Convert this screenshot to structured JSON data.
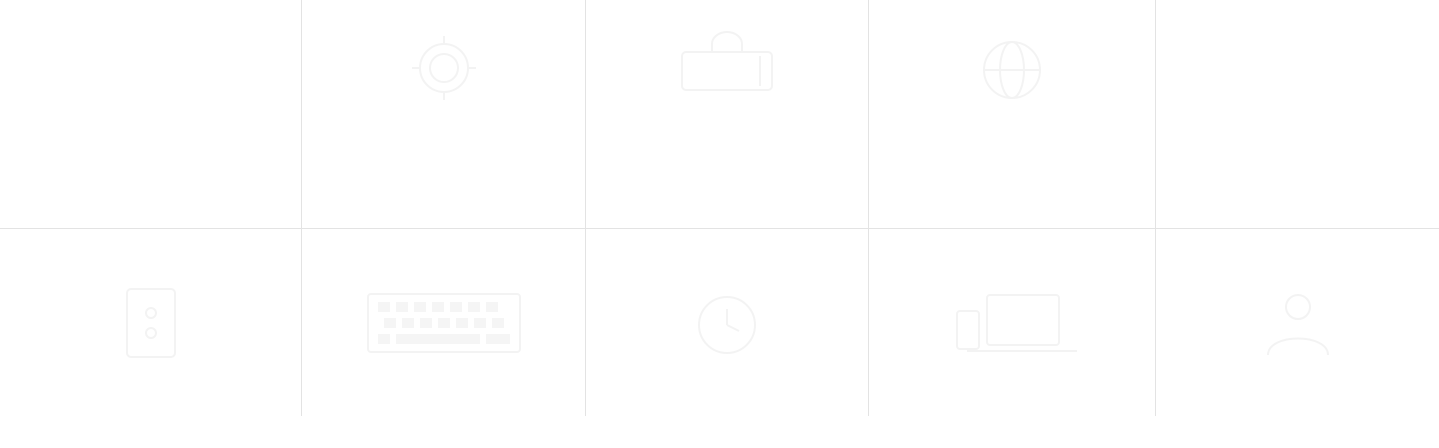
{
  "colors": {
    "background": "#ffffff",
    "grid_line": "#e3e3e3",
    "icon_ghost": "#f3f3f3"
  },
  "icon_grid": {
    "rows": [
      {
        "cells": [
          {
            "icon": "empty"
          },
          {
            "icon": "gear-icon"
          },
          {
            "icon": "shopping-bag-icon"
          },
          {
            "icon": "globe-icon"
          },
          {
            "icon": "empty"
          }
        ]
      },
      {
        "cells": [
          {
            "icon": "phone-icon"
          },
          {
            "icon": "keyboard-icon"
          },
          {
            "icon": "clock-icon"
          },
          {
            "icon": "laptop-icon"
          },
          {
            "icon": "user-icon"
          }
        ]
      }
    ]
  }
}
